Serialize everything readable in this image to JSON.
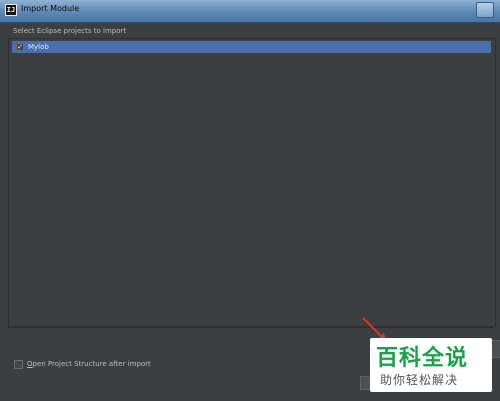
{
  "window": {
    "title": "Import Module",
    "icon": "intellij-app-icon"
  },
  "projects_section": {
    "label": "Select Eclipse projects to import",
    "items": [
      {
        "label": "Mylob",
        "checked": true,
        "selected": true
      }
    ]
  },
  "options": {
    "open_structure_mnemonic": "O",
    "open_structure_rest": "pen Project Structure after import",
    "open_structure_checked": false
  },
  "watermark": {
    "main": "百科全说",
    "sub": "助你轻松解决"
  },
  "colors": {
    "selection": "#4b6eaf",
    "background": "#3c3f41",
    "annotation_arrow": "#d23c2c",
    "watermark_green": "#18a34a"
  }
}
